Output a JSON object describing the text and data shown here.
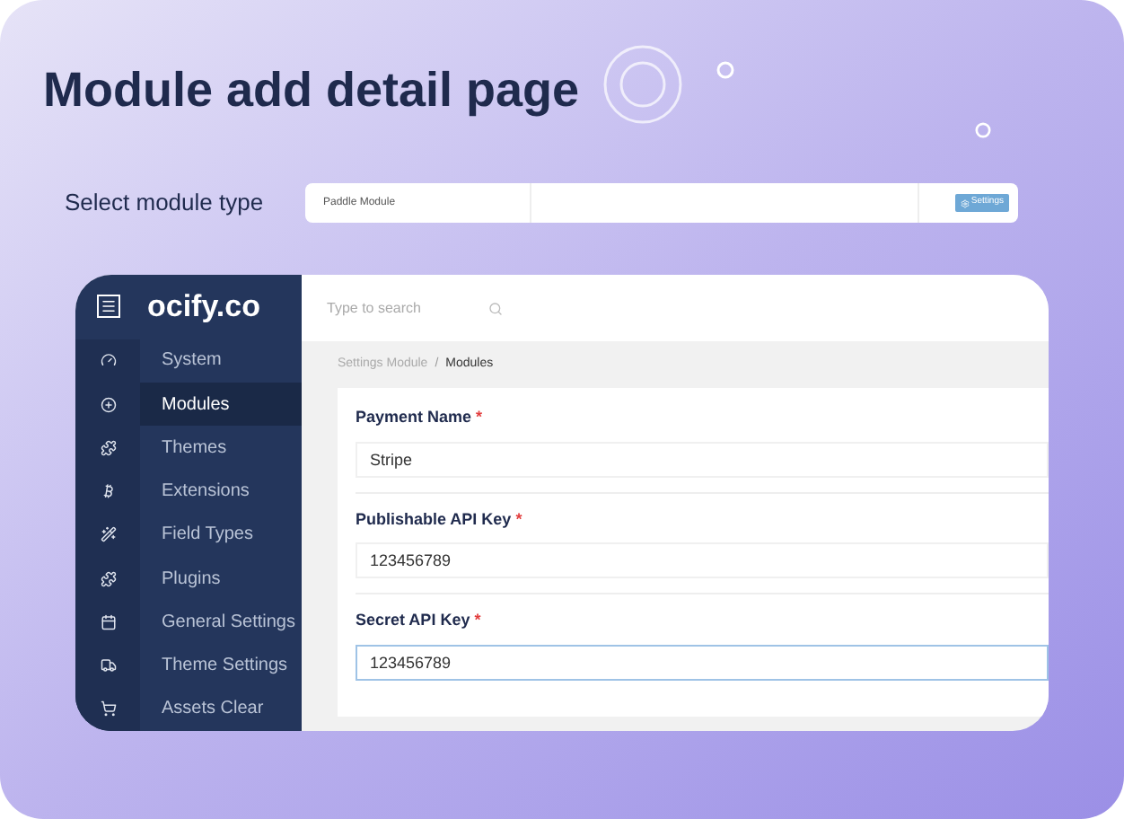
{
  "title": "Module add detail page",
  "module_type": {
    "label": "Select module type",
    "value": "Paddle Module",
    "button": "Settings"
  },
  "logo": "ocify.co",
  "sidebar": {
    "items": [
      {
        "label": "System",
        "selected": false
      },
      {
        "label": "Modules",
        "selected": true
      },
      {
        "label": "Themes",
        "selected": false
      },
      {
        "label": "Extensions",
        "selected": false
      },
      {
        "label": "Field Types",
        "selected": false
      },
      {
        "label": "Plugins",
        "selected": false
      },
      {
        "label": "General Settings",
        "selected": false
      },
      {
        "label": "Theme Settings",
        "selected": false
      },
      {
        "label": "Assets Clear",
        "selected": false
      }
    ]
  },
  "search": {
    "placeholder": "Type to search"
  },
  "breadcrumb": {
    "separator": "/",
    "items": [
      "Settings Module",
      "Modules"
    ]
  },
  "fields": [
    {
      "label": "Payment Name",
      "required": "*",
      "value": "Stripe",
      "focused": false
    },
    {
      "label": "Publishable API Key",
      "required": "*",
      "value": "123456789",
      "focused": false
    },
    {
      "label": "Secret API Key",
      "required": "*",
      "value": "123456789",
      "focused": true
    }
  ]
}
